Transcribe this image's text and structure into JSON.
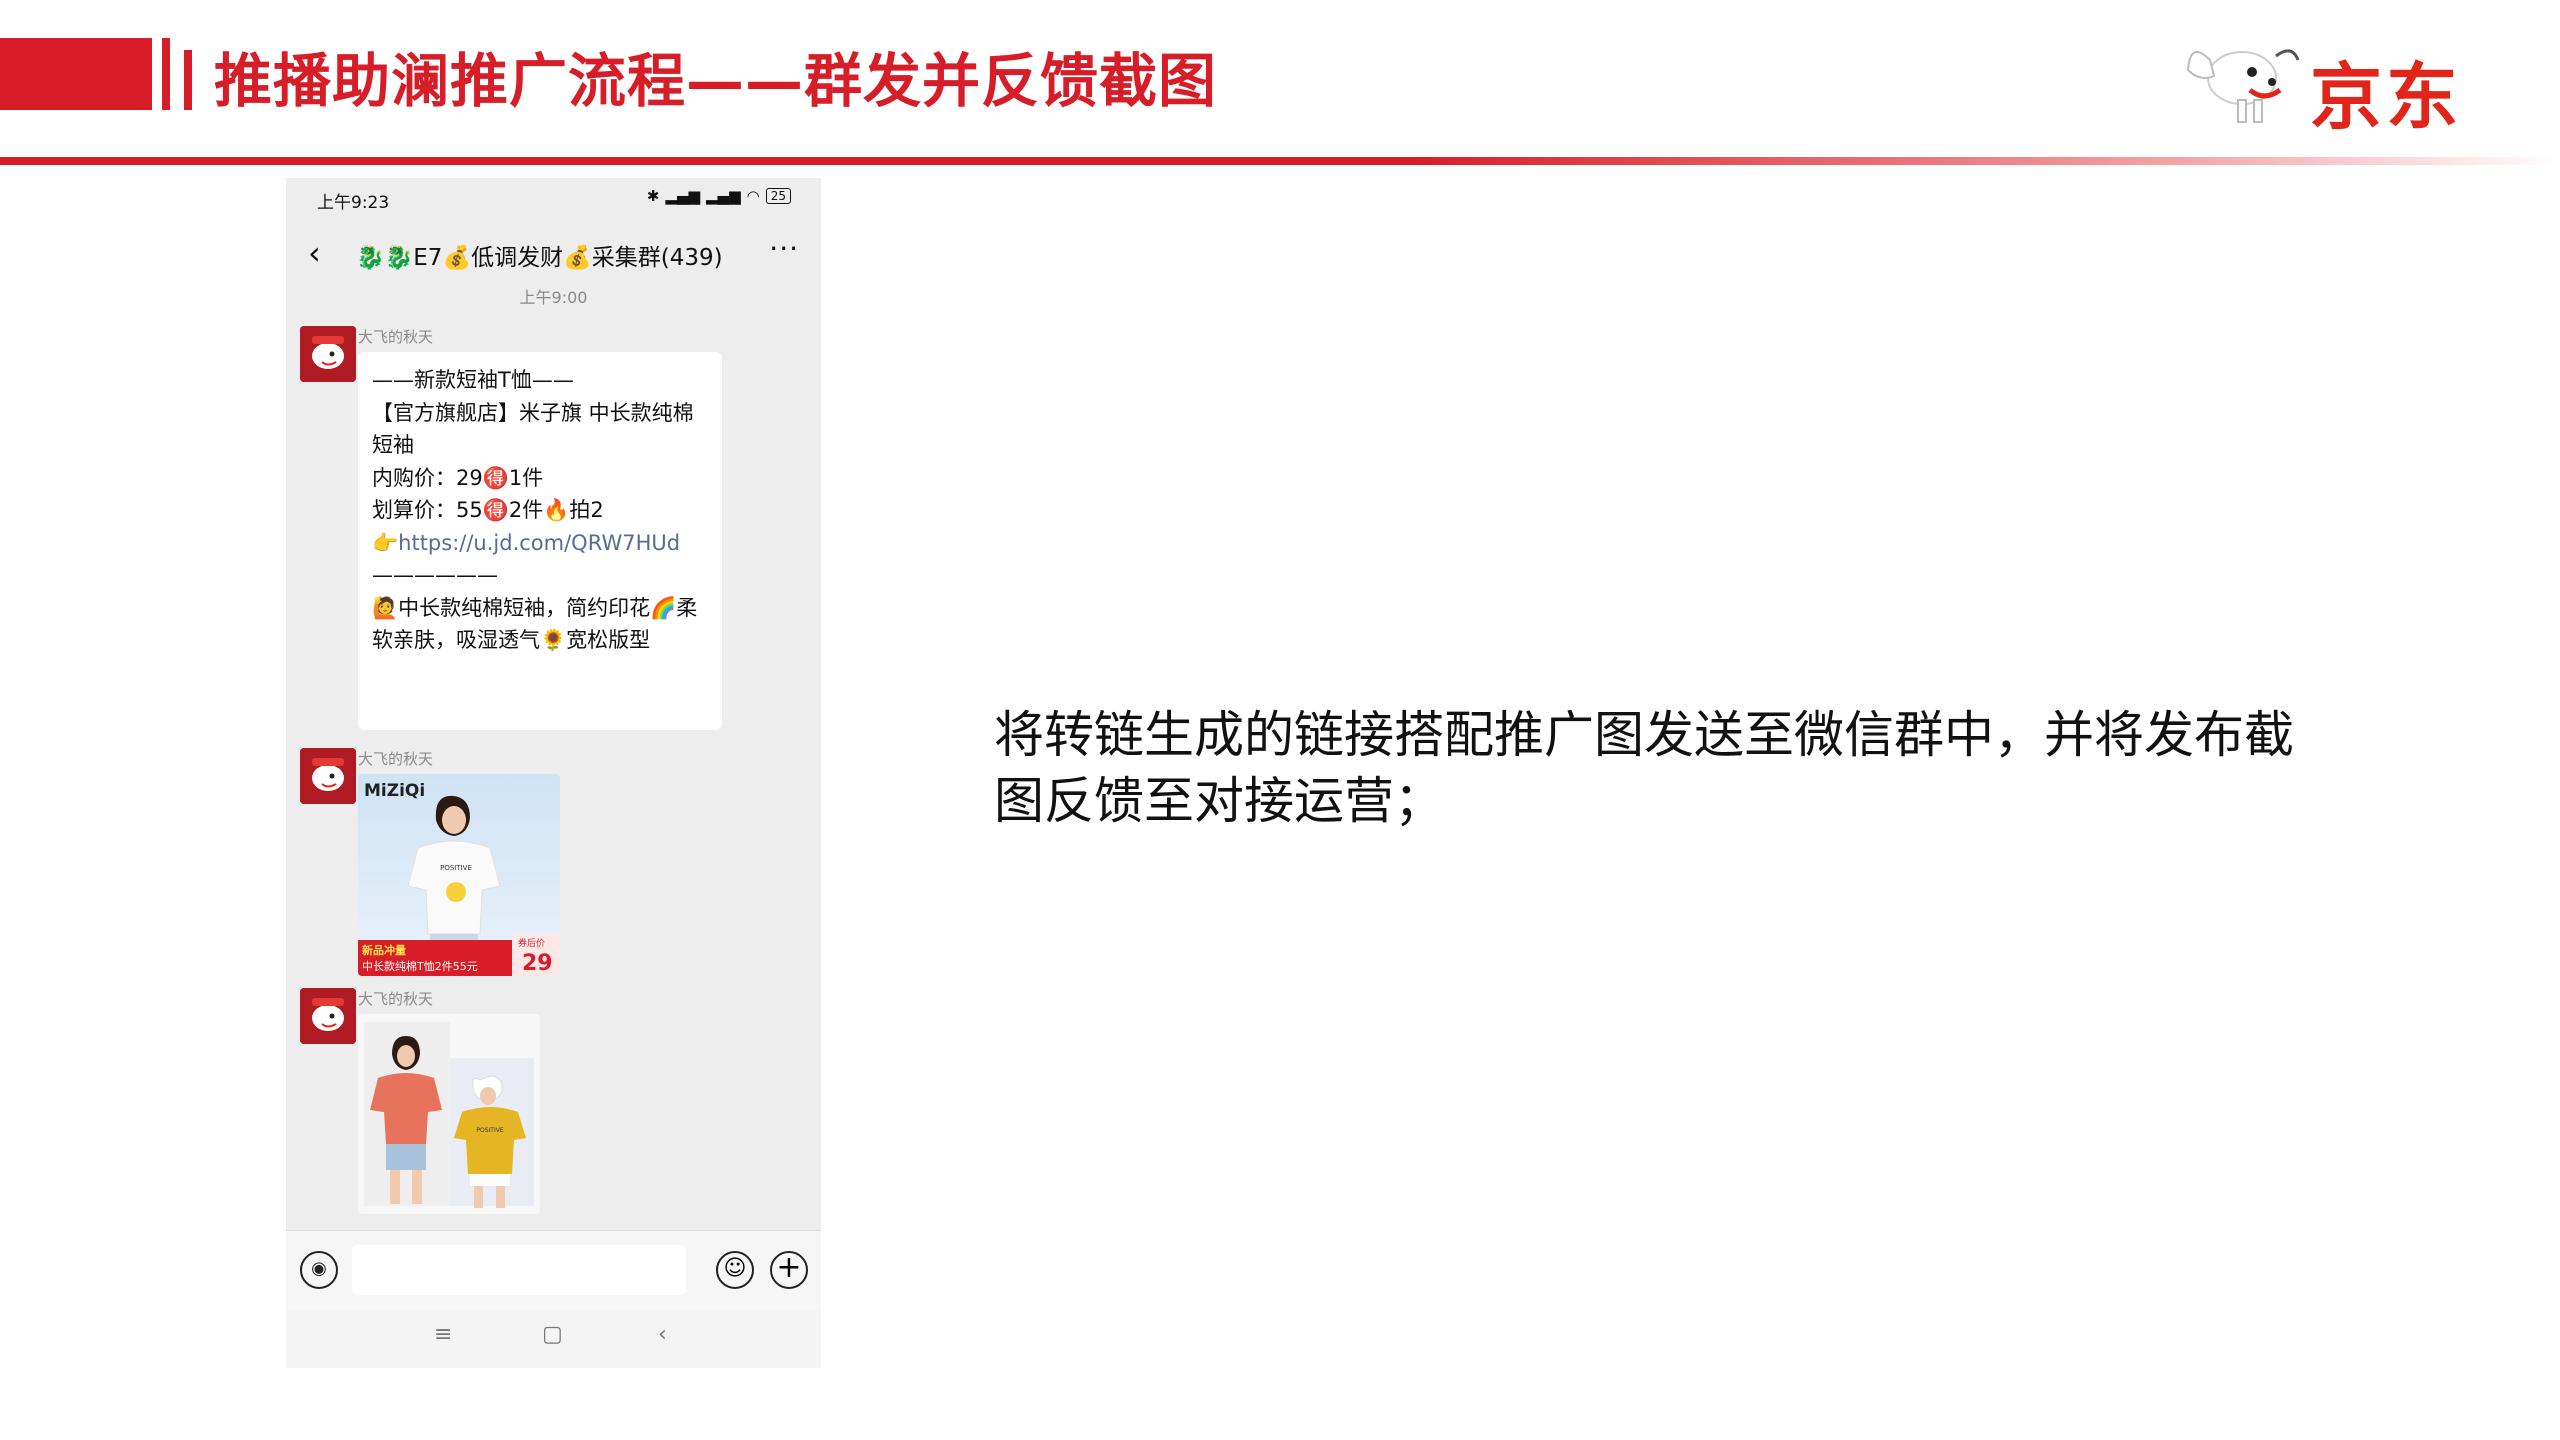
{
  "header": {
    "title": "推播助澜推广流程——群发并反馈截图",
    "logo_text": "京东"
  },
  "phone": {
    "status": {
      "time": "上午9:23",
      "battery": "25"
    },
    "chat_title": "🐉🐉E7💰低调发财💰采集群(439)",
    "timestamp": "上午9:00",
    "messages": [
      {
        "sender": "大飞的秋天",
        "lines": [
          "——新款短袖T恤——",
          "",
          "【官方旗舰店】米子旗 中长款纯棉短袖",
          "",
          "内购价：29🉐1件",
          "划算价：55🉐2件🔥拍2",
          "👉https://u.jd.com/QRW7HUd",
          "——————",
          "🙋中长款纯棉短袖，简约印花🌈柔软亲肤，吸湿透气🌻宽松版型"
        ],
        "link": "https://u.jd.com/QRW7HUd"
      },
      {
        "sender": "大飞的秋天",
        "image": {
          "brand": "MiZiQi",
          "tag": "新品冲量",
          "caption": "中长款纯棉T恤2件55元",
          "price_label": "券后价",
          "price": "29",
          "shirt_text": "POSITIVE"
        }
      },
      {
        "sender": "大飞的秋天",
        "image": {
          "shirt_text": "POSITIVE"
        }
      }
    ]
  },
  "description": "将转链生成的链接搭配推广图发送至微信群中，并将发布截图反馈至对接运营；",
  "colors": {
    "brand_red": "#d71d28",
    "wechat_bg": "#ededed",
    "link_blue": "#576b95"
  }
}
